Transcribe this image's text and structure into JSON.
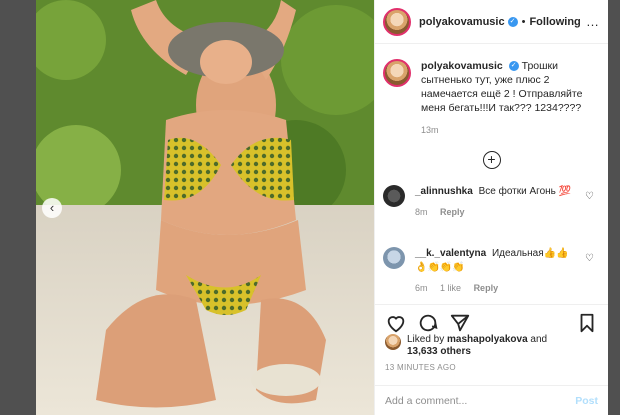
{
  "post": {
    "author": "polyakovamusic",
    "verified_mark": "✓",
    "separator": "•",
    "follow_status": "Following",
    "more_icon": "…",
    "caption": "Трошки сытненько тут, уже плюс 2 намечается ещё 2 ! Отправляйте меня бегать!!!И так??? 1234????",
    "caption_time": "13m"
  },
  "carousel": {
    "prev_icon": "‹"
  },
  "load_more": {
    "icon": "+"
  },
  "comments": [
    {
      "user": "_alinnushka",
      "text": "Все фотки Агонь 💯",
      "time": "8m",
      "reply": "Reply"
    },
    {
      "user": "__k._valentyna",
      "text": "Идеальная👍👍 👌👏👏👏",
      "time": "6m",
      "likes": "1 like",
      "reply": "Reply"
    }
  ],
  "actions": {
    "icons": [
      "heart-icon",
      "comment-icon",
      "share-icon",
      "bookmark-icon"
    ]
  },
  "likes": {
    "prefix": "Liked by",
    "user": "mashapolyakova",
    "and": "and",
    "count": "13,633 others"
  },
  "timestamp": "13 MINUTES AGO",
  "add_comment": {
    "placeholder": "Add a comment...",
    "post_label": "Post"
  },
  "colors": {
    "verified": "#3897f0",
    "post_disabled": "#b2dffc",
    "story_ring": "#e1306c"
  }
}
